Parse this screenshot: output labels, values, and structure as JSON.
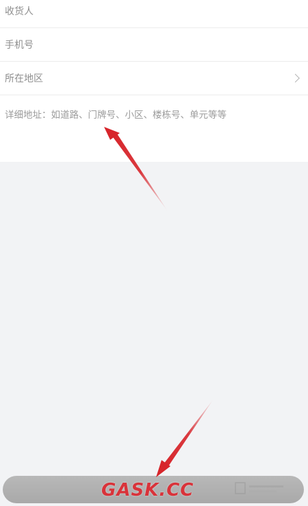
{
  "form": {
    "recipient_placeholder": "收货人",
    "phone_placeholder": "手机号",
    "region_label": "所在地区",
    "address_placeholder": "详细地址：如道路、门牌号、小区、楼栋号、单元等等"
  },
  "watermark": {
    "text": "GASK.CC"
  },
  "icons": {
    "region_chevron": "chevron-right-icon"
  },
  "colors": {
    "background": "#f2f3f5",
    "form_bg": "#ffffff",
    "button_bg": "#aeaeae",
    "arrow": "#d7252b"
  }
}
